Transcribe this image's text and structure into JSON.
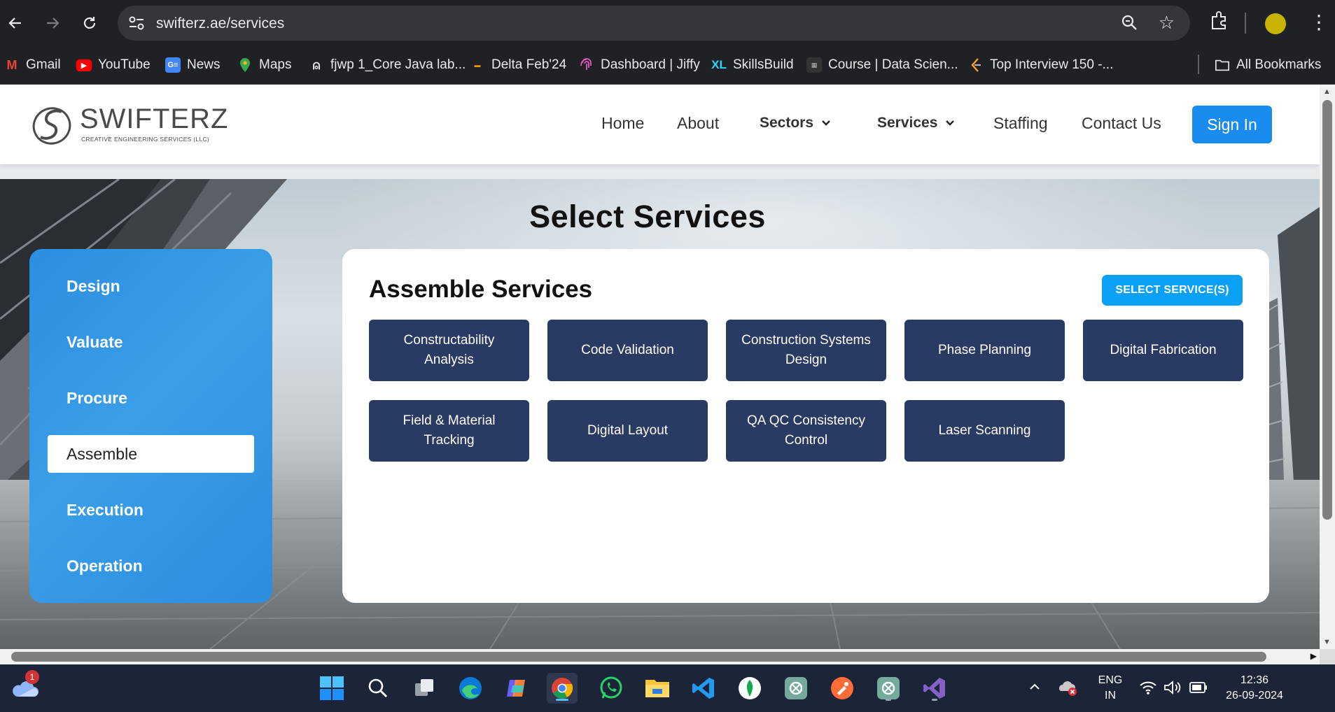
{
  "browser": {
    "url": "swifterz.ae/services",
    "bookmarks": [
      {
        "label": "Gmail",
        "icon": "gmail-icon"
      },
      {
        "label": "YouTube",
        "icon": "youtube-icon"
      },
      {
        "label": "News",
        "icon": "news-icon"
      },
      {
        "label": "Maps",
        "icon": "maps-icon"
      },
      {
        "label": "fjwp 1_Core Java lab...",
        "icon": "figure-icon"
      },
      {
        "label": "Delta Feb'24",
        "icon": "college-icon"
      },
      {
        "label": "Dashboard | Jiffy",
        "icon": "fingerprint-icon"
      },
      {
        "label": "SkillsBuild",
        "icon": "skillsbuild-icon"
      },
      {
        "label": "Course | Data Scien...",
        "icon": "course-icon"
      },
      {
        "label": "Top Interview 150 -...",
        "icon": "leetcode-icon"
      }
    ],
    "all_bookmarks": "All Bookmarks"
  },
  "site": {
    "logo_word": "SWIFTERZ",
    "logo_tagline": "CREATIVE ENGINEERING SERVICES (LLC)",
    "nav": {
      "home": "Home",
      "about": "About",
      "sectors": "Sectors",
      "services": "Services",
      "staffing": "Staffing",
      "contact": "Contact Us",
      "signin": "Sign In"
    },
    "brand_color": "#1a8cf0"
  },
  "page": {
    "title": "Select Services",
    "categories": [
      "Design",
      "Valuate",
      "Procure",
      "Assemble",
      "Execution",
      "Operation"
    ],
    "active_category": "Assemble",
    "services_heading": "Assemble Services",
    "select_button": "SELECT SERVICE(S)",
    "services": [
      "Constructability Analysis",
      "Code Validation",
      "Construction Systems Design",
      "Phase Planning",
      "Digital Fabrication",
      "Field & Material Tracking",
      "Digital Layout",
      "QA QC Consistency Control",
      "Laser Scanning"
    ],
    "service_button_color": "#2a3b63"
  },
  "taskbar": {
    "weather_badge": "1",
    "lang_line1": "ENG",
    "lang_line2": "IN",
    "time": "12:36",
    "date": "26-09-2024"
  }
}
